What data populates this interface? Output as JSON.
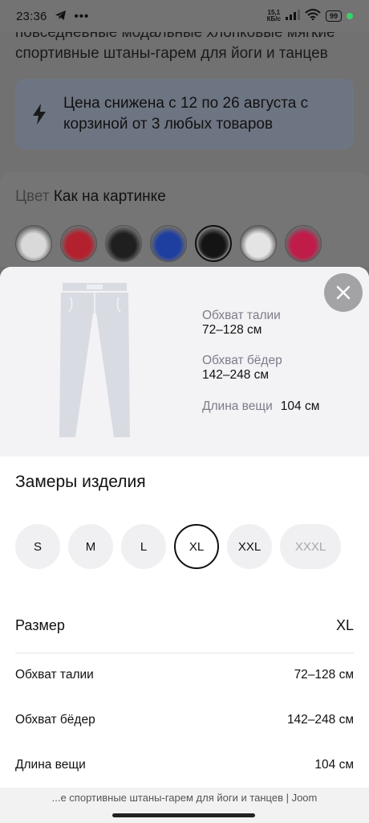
{
  "status_bar": {
    "time": "23:36",
    "net_speed_value": "15,1",
    "net_speed_unit": "КБ/с",
    "battery": "99",
    "icons": [
      "telegram-icon",
      "more-icon",
      "signal-icon",
      "wifi-icon",
      "battery-icon"
    ]
  },
  "background_page": {
    "title": "повседневные модальные хлопковые мягкие спортивные штаны-гарем для йоги и танцев",
    "promo": "Цена снижена с 12 по 26 августа с корзиной от 3 любых товаров",
    "color_label": "Цвет",
    "color_value": "Как на картинке",
    "swatches": [
      {
        "color": "#d9d9d9"
      },
      {
        "color": "#b3202e"
      },
      {
        "color": "#1f1f1f"
      },
      {
        "color": "#1f3fa0"
      },
      {
        "color": "#141414",
        "selected": true
      },
      {
        "color": "#e4e4e4"
      },
      {
        "color": "#c01c4a"
      }
    ]
  },
  "sheet": {
    "hero": {
      "waist_label": "Обхват талии",
      "waist_value": "72–128 см",
      "hips_label": "Обхват бёдер",
      "hips_value": "142–248 см",
      "length_label": "Длина вещи",
      "length_value": "104 см"
    },
    "title": "Замеры изделия",
    "sizes": [
      {
        "label": "S"
      },
      {
        "label": "M"
      },
      {
        "label": "L"
      },
      {
        "label": "XL",
        "selected": true
      },
      {
        "label": "XXL"
      },
      {
        "label": "XXXL",
        "disabled": true
      }
    ],
    "table": {
      "size_label": "Размер",
      "size_value": "XL",
      "rows": [
        {
          "label": "Обхват талии",
          "value": "72–128 см"
        },
        {
          "label": "Обхват бёдер",
          "value": "142–248 см"
        },
        {
          "label": "Длина вещи",
          "value": "104 см"
        }
      ]
    }
  },
  "footer": {
    "page_title": "...е спортивные штаны-гарем для йоги и танцев | Joom"
  }
}
